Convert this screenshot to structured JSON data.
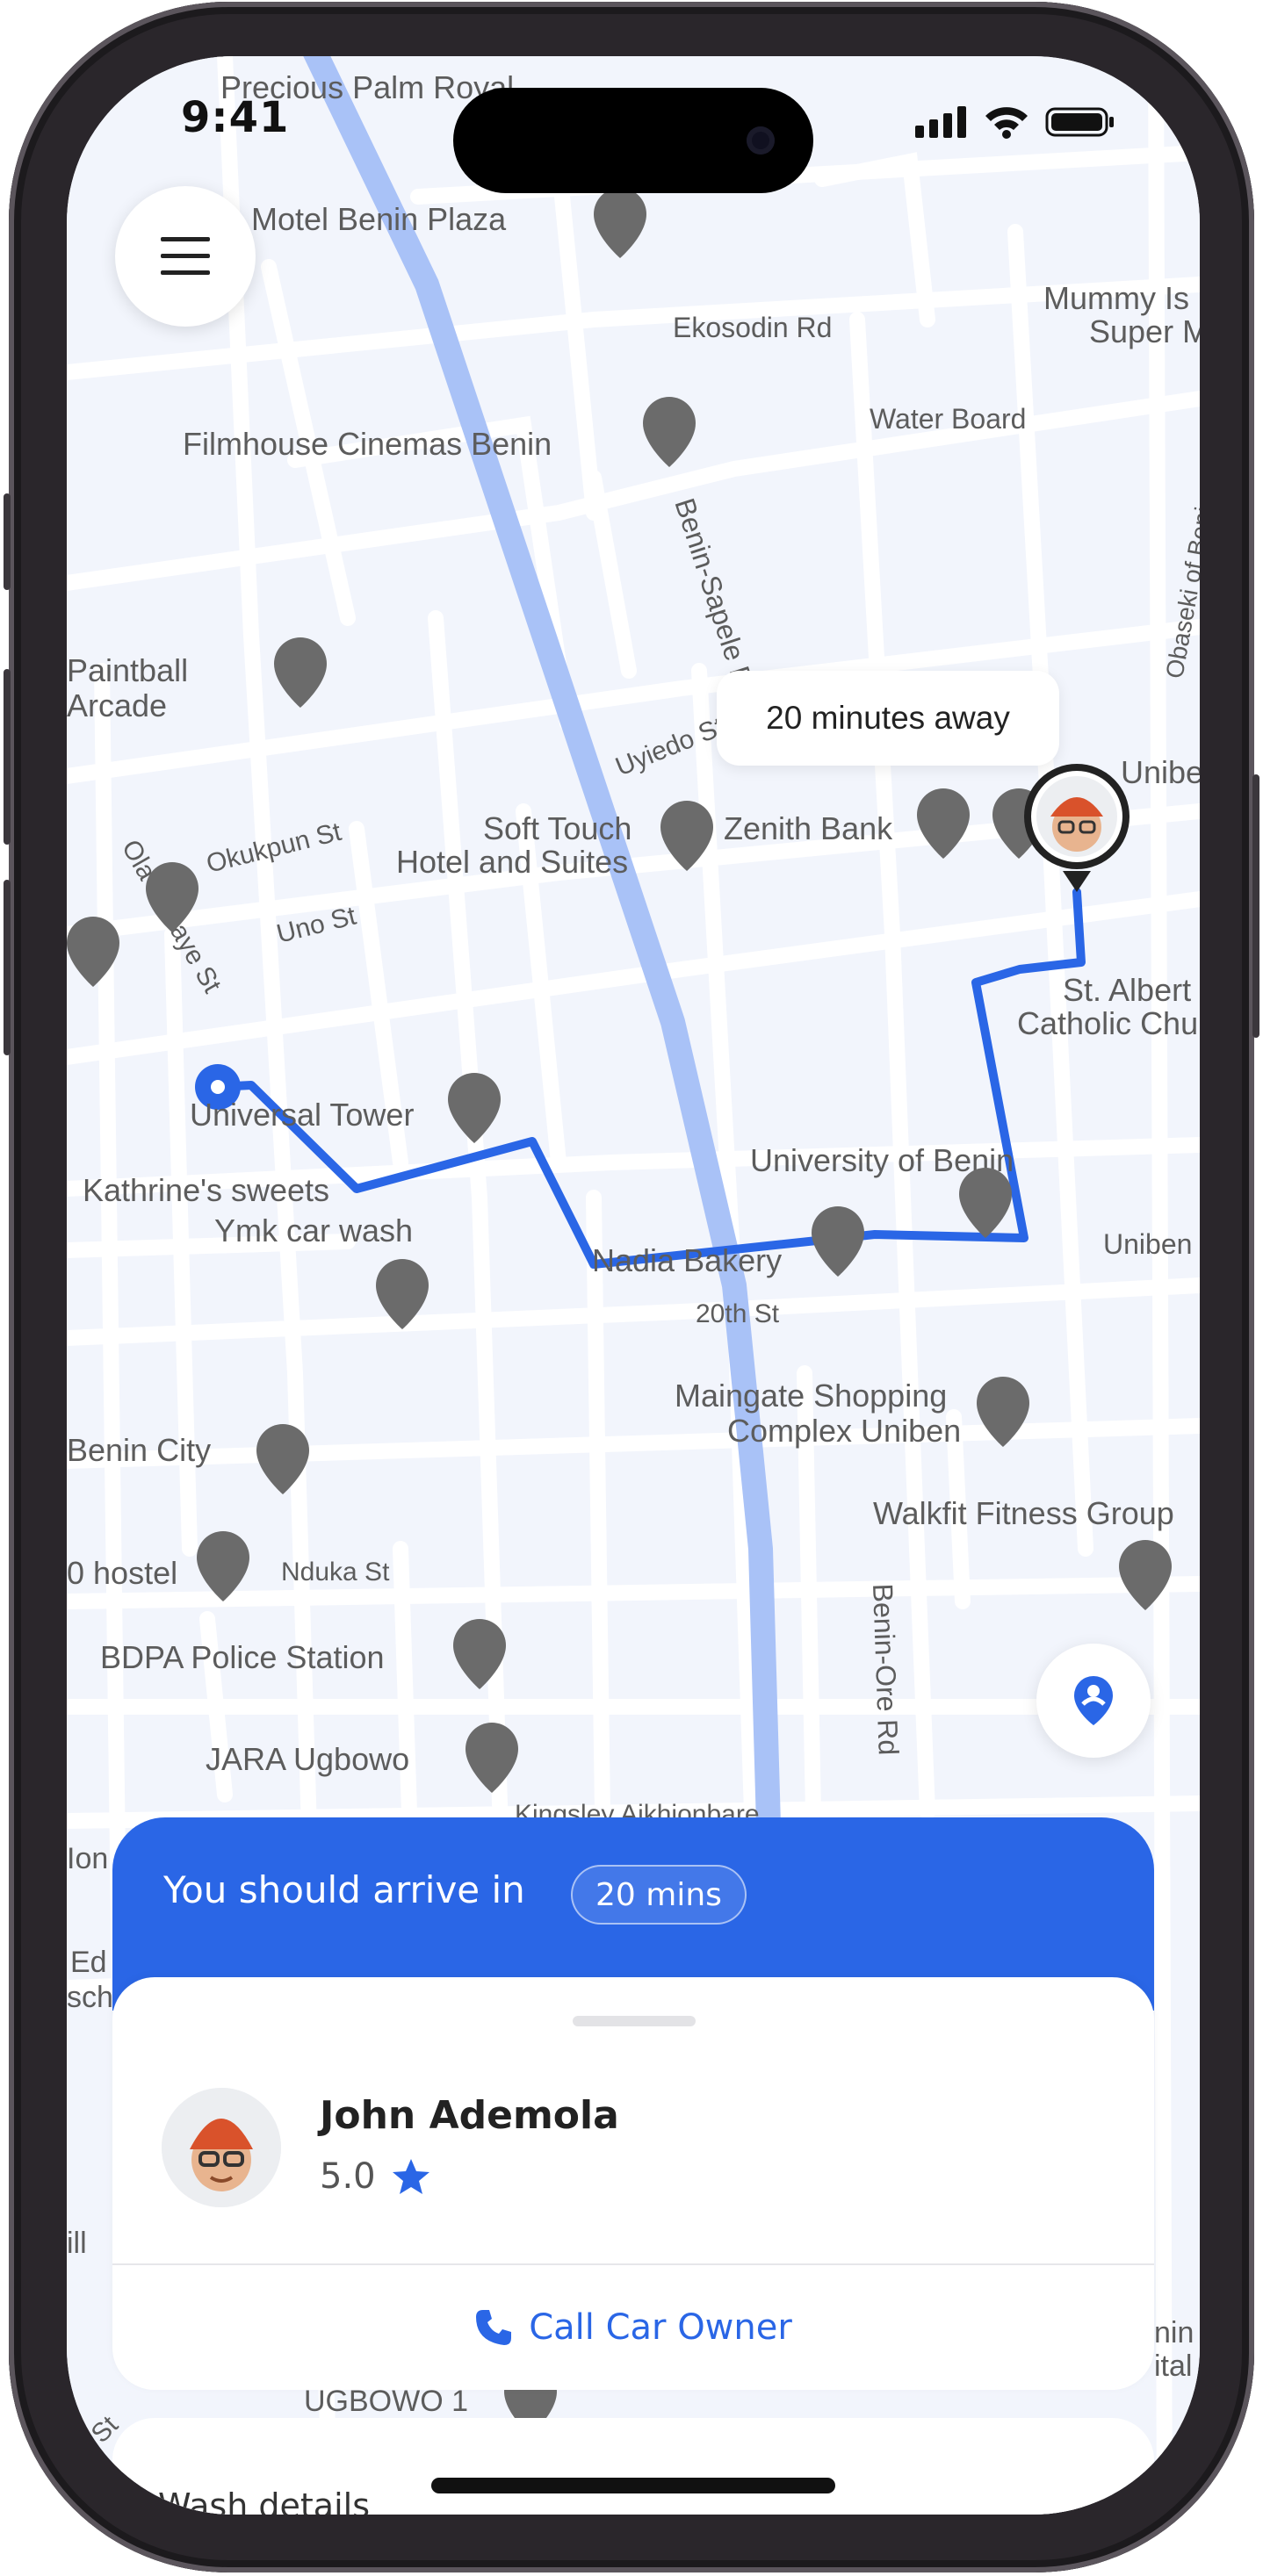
{
  "status_bar": {
    "time": "9:41"
  },
  "map": {
    "places": [
      "Precious Palm Royal",
      "Motel Benin Plaza",
      "Ekosodin Rd",
      "Mummy Is",
      "Super M",
      "Water Board",
      "Filmhouse Cinemas Benin",
      "Benin-Sapele Rd",
      "Obaseki of Benin",
      "Paintball",
      "Arcade",
      "Uyiedo St",
      "Uniben F",
      "Okukpun St",
      "Soft Touch",
      "Hotel and Suites",
      "Zenith Bank",
      "Uno St",
      "Ola Okeaye St",
      "St. Albert",
      "Catholic Church...",
      "Universal Tower",
      "University of Benin",
      "Kathrine's sweets",
      "Ymk car wash",
      "Nadia Bakery",
      "Uniben",
      "20th St",
      "Maingate Shopping",
      "Complex Uniben",
      "Benin City",
      "Walkfit Fitness Group",
      "0 hostel",
      "Nduka St",
      "Benin-Ore Rd",
      "BDPA Police Station",
      "JARA Ugbowo",
      "Kingsley Aikhionbare",
      "UGBOWO 1",
      "Ion",
      "Ed",
      "sch",
      "ill",
      "nin",
      "ital",
      "St"
    ],
    "eta_bubble": "20 minutes away",
    "route_color": "#2a66e6",
    "highway_color": "#a9c2f7"
  },
  "arrival": {
    "label": "You should arrive in",
    "eta": "20 mins",
    "accent": "#2a66e6"
  },
  "driver": {
    "name": "John Ademola",
    "rating": "5.0",
    "call_label": "Call Car Owner"
  },
  "wash": {
    "label": "Wash details"
  },
  "icons": [
    "menu-icon",
    "locate-me-icon",
    "phone-icon",
    "star-icon",
    "signal-icon",
    "wifi-icon",
    "battery-icon"
  ]
}
